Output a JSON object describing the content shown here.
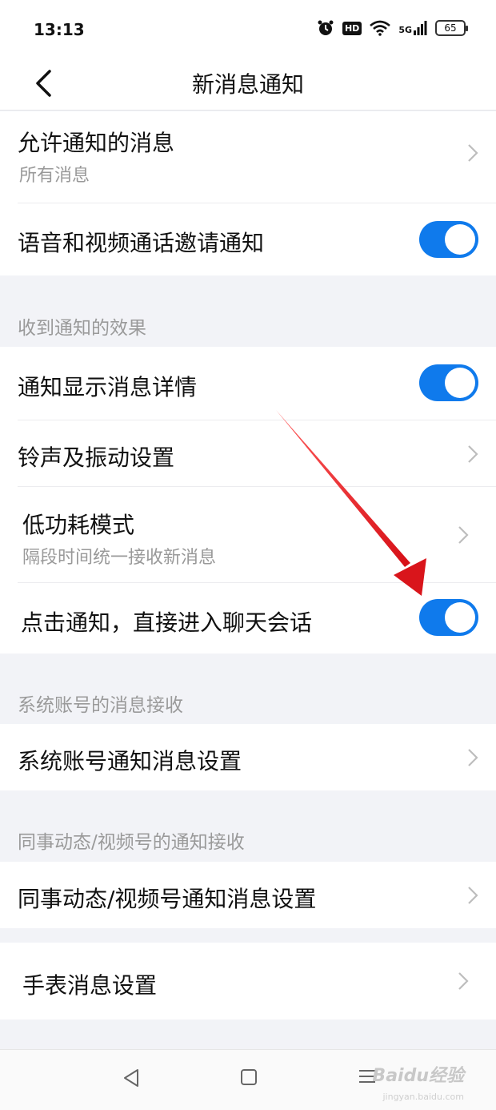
{
  "status": {
    "time": "13:13",
    "hd": "HD",
    "network": "5G",
    "battery": "65",
    "icons": [
      "alarm-icon",
      "hd-icon",
      "wifi-icon",
      "signal-icon",
      "battery-icon"
    ]
  },
  "header": {
    "title": "新消息通知",
    "back_icon": "chevron-left-icon"
  },
  "sections": {
    "effects_title": "收到通知的效果",
    "system_title": "系统账号的消息接收",
    "colleague_title": "同事动态/视频号的通知接收"
  },
  "items": {
    "allowed_messages": {
      "label": "允许通知的消息",
      "value": "所有消息"
    },
    "voice_video_invite": {
      "label": "语音和视频通话邀请通知",
      "on": true
    },
    "show_details": {
      "label": "通知显示消息详情",
      "on": true
    },
    "ringtone": {
      "label": "铃声及振动设置"
    },
    "low_power": {
      "label": "低功耗模式",
      "sub": "隔段时间统一接收新消息"
    },
    "tap_to_chat": {
      "label": "点击通知，直接进入聊天会话",
      "on": true
    },
    "system_account": {
      "label": "系统账号通知消息设置"
    },
    "colleague_video": {
      "label": "同事动态/视频号通知消息设置"
    },
    "watch": {
      "label": "手表消息设置"
    }
  },
  "colors": {
    "toggle_on": "#0f7aec",
    "background": "#f2f3f7",
    "annotation_arrow": "#e8161c"
  },
  "watermark": {
    "brand": "Baidu经验",
    "site": "jingyan.baidu.com"
  }
}
